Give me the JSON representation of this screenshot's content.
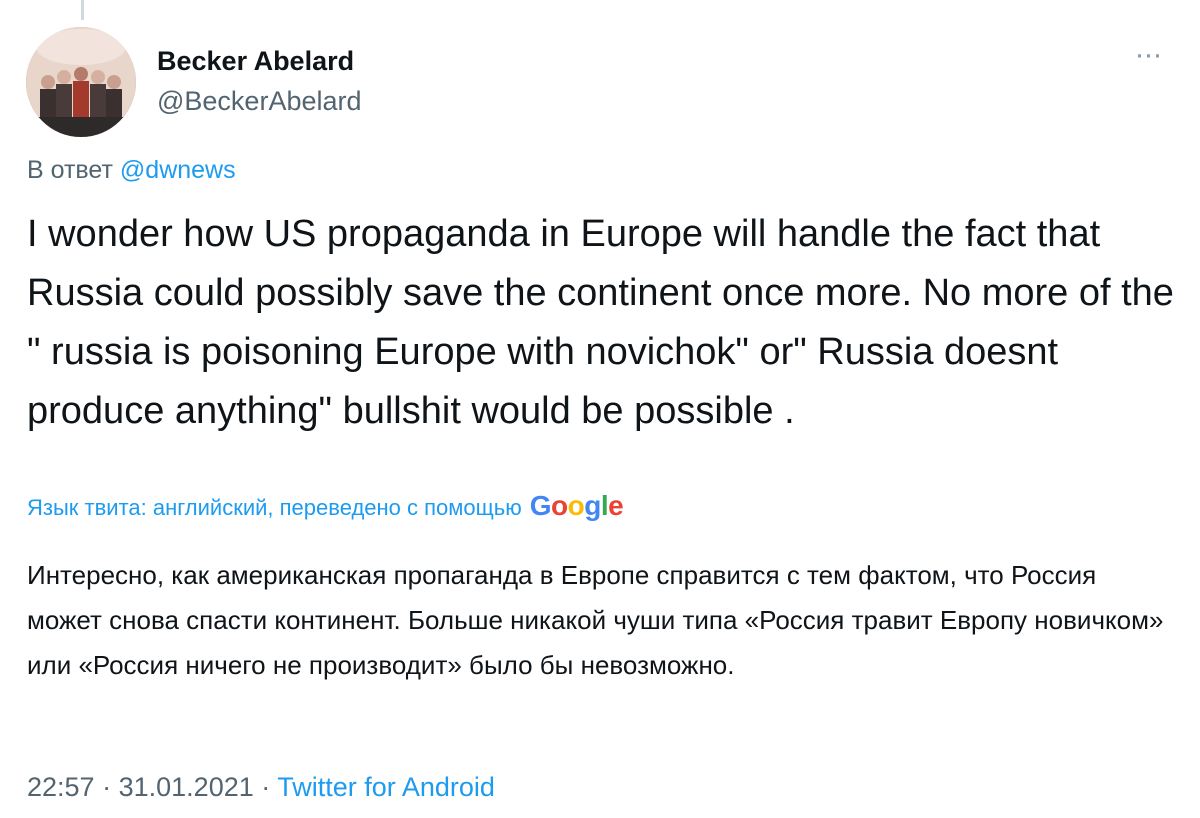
{
  "thread": {
    "connector": "reply-thread-line"
  },
  "author": {
    "name": "Becker Abelard",
    "handle": "@BeckerAbelard",
    "avatar": "group-photo-avatar"
  },
  "menu": {
    "more_icon": "more-dots-icon",
    "more_label": "···"
  },
  "reply": {
    "prefix": "В ответ",
    "mention": "@dwnews"
  },
  "tweet": {
    "text": "I wonder how US propaganda in Europe will handle the fact that Russia could possibly save the continent once more. No more of the \" russia is poisoning Europe with novichok\" or\" Russia doesnt produce anything\" bullshit would be possible ."
  },
  "translation": {
    "label": "Язык твита: английский, переведено с помощью",
    "provider_letters": [
      "G",
      "o",
      "o",
      "g",
      "l",
      "e"
    ],
    "text": "Интересно, как американская пропаганда в Европе справится с тем фактом, что Россия может снова спасти континент. Больше никакой чуши типа «Россия травит Европу новичком» или «Россия ничего не производит» было бы невозможно."
  },
  "meta": {
    "time": "22:57",
    "separator": "·",
    "date": "31.01.2021",
    "source": "Twitter for Android"
  },
  "colors": {
    "link": "#1d9bf0",
    "secondary_text": "#536471",
    "primary_text": "#0f1419"
  }
}
